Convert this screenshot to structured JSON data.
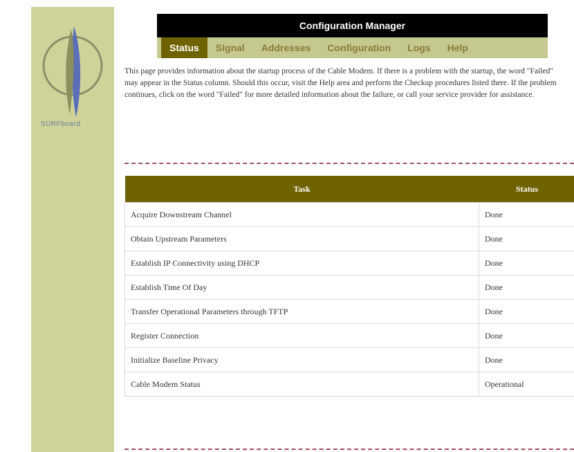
{
  "brand": {
    "name": "SURFboard"
  },
  "header": {
    "title": "Configuration Manager"
  },
  "nav": {
    "tabs": [
      {
        "label": "Status",
        "active": true
      },
      {
        "label": "Signal",
        "active": false
      },
      {
        "label": "Addresses",
        "active": false
      },
      {
        "label": "Configuration",
        "active": false
      },
      {
        "label": "Logs",
        "active": false
      },
      {
        "label": "Help",
        "active": false
      }
    ]
  },
  "intro_text": "This page provides information about the startup process of the Cable Modem. If there is a problem with the startup, the word \"Failed\" may appear in the Status column. Should this occur, visit the Help area and perform the Checkup procedures listed there. If the problem continues, click on the word \"Failed\" for more detailed information about the failure, or call your service provider for assistance.",
  "table": {
    "headers": {
      "task": "Task",
      "status": "Status"
    },
    "rows": [
      {
        "task": "Acquire Downstream Channel",
        "status": "Done"
      },
      {
        "task": "Obtain Upstream Parameters",
        "status": "Done"
      },
      {
        "task": "Establish IP Connectivity using DHCP",
        "status": "Done"
      },
      {
        "task": "Establish Time Of Day",
        "status": "Done"
      },
      {
        "task": "Transfer Operational Parameters through TFTP",
        "status": "Done"
      },
      {
        "task": "Register Connection",
        "status": "Done"
      },
      {
        "task": "Initialize Baseline Privacy",
        "status": "Done"
      },
      {
        "task": "Cable Modem Status",
        "status": "Operational"
      }
    ]
  }
}
